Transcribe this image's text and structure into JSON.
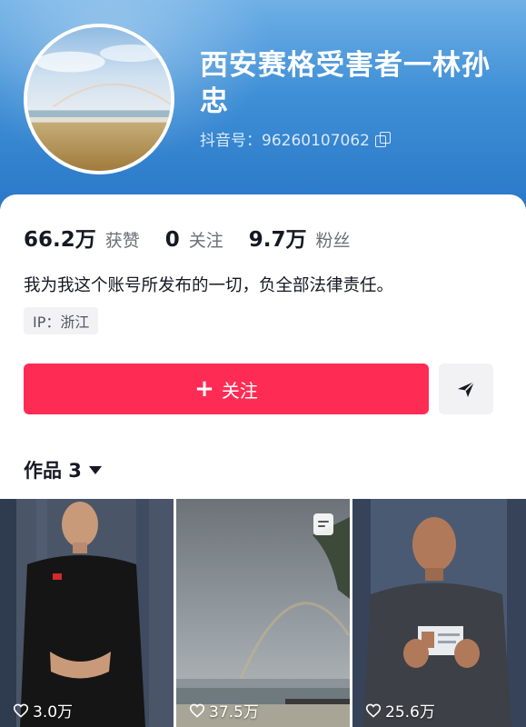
{
  "profile": {
    "name": "西安赛格受害者一林孙忠",
    "douyin_id": "抖音号：96260107062"
  },
  "stats": [
    {
      "num": "66.2万",
      "label": "获赞"
    },
    {
      "num": "0",
      "label": "关注"
    },
    {
      "num": "9.7万",
      "label": "粉丝"
    }
  ],
  "bio": "我为我这个账号所发布的一切，负全部法律责任。",
  "ip": "IP：浙江",
  "actions": {
    "follow_label": "关注",
    "follow_plus": "+",
    "share_icon": "send-arrow-icon"
  },
  "works": {
    "label": "作品 3",
    "items": [
      {
        "likes": "3.0万"
      },
      {
        "likes": "37.5万"
      },
      {
        "likes": "25.6万"
      }
    ]
  },
  "colors": {
    "accent": "#fe2c55",
    "banner": "#3f8fd6"
  }
}
